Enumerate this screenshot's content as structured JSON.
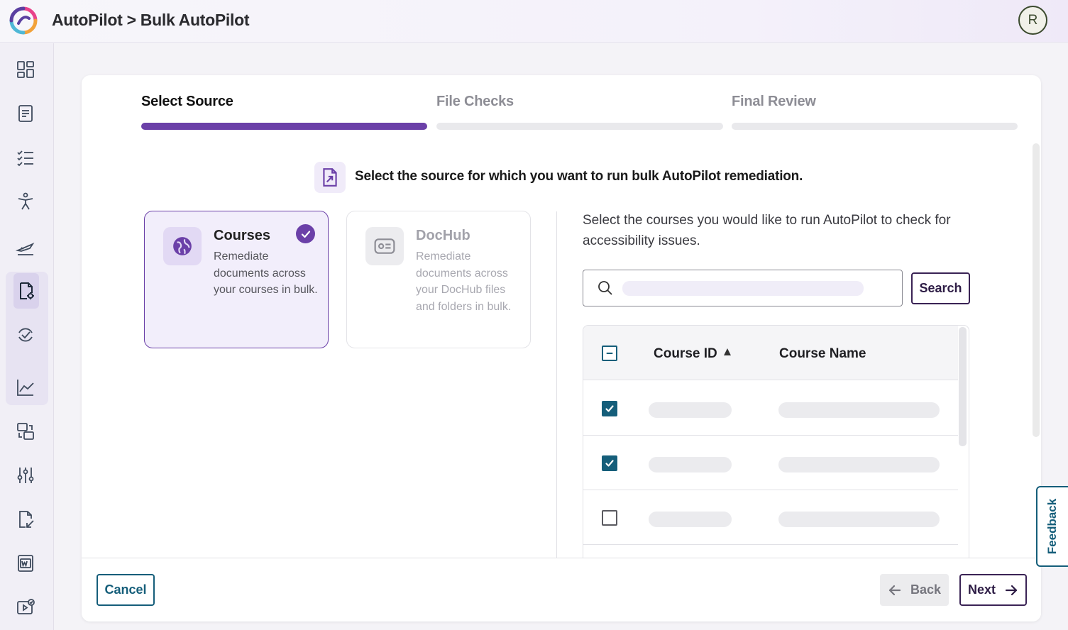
{
  "header": {
    "title": "AutoPilot > Bulk AutoPilot",
    "avatar_initial": "R"
  },
  "sidebar": {
    "items": [
      {
        "icon": "dashboard-icon"
      },
      {
        "icon": "document-icon"
      },
      {
        "icon": "checklist-icon"
      },
      {
        "icon": "accessibility-icon"
      },
      {
        "icon": "autopilot-plane-icon"
      },
      {
        "icon": "bulk-document-icon",
        "active": true
      },
      {
        "icon": "reviewed-check-icon"
      },
      {
        "icon": "analytics-chart-icon"
      },
      {
        "icon": "conversion-icon"
      },
      {
        "icon": "settings-sliders-icon"
      },
      {
        "icon": "document-edit-icon"
      },
      {
        "icon": "word-document-icon"
      },
      {
        "icon": "video-check-icon"
      }
    ]
  },
  "steps": [
    {
      "label": "Select Source",
      "state": "active"
    },
    {
      "label": "File Checks",
      "state": "pending"
    },
    {
      "label": "Final Review",
      "state": "pending"
    }
  ],
  "instruction": "Select the source for which you want to run bulk AutoPilot remediation.",
  "sources": [
    {
      "title": "Courses",
      "description": "Remediate documents across your courses in bulk.",
      "selected": true
    },
    {
      "title": "DocHub",
      "description": "Remediate documents across your DocHub files and folders in bulk.",
      "selected": false
    }
  ],
  "courses_panel": {
    "instruction": "Select the courses you would like to run AutoPilot to check for accessibility issues.",
    "search": {
      "value": "",
      "placeholder": "",
      "button_label": "Search"
    },
    "table": {
      "columns": [
        "Course ID",
        "Course Name"
      ],
      "sort": {
        "column": "Course ID",
        "direction": "asc"
      },
      "rows": [
        {
          "checked": true
        },
        {
          "checked": true
        },
        {
          "checked": false
        }
      ]
    }
  },
  "footer": {
    "cancel_label": "Cancel",
    "back_label": "Back",
    "next_label": "Next"
  },
  "feedback_label": "Feedback",
  "colors": {
    "accent_purple": "#6b40a8",
    "teal": "#155e7a",
    "dark_purple": "#3a2355"
  }
}
